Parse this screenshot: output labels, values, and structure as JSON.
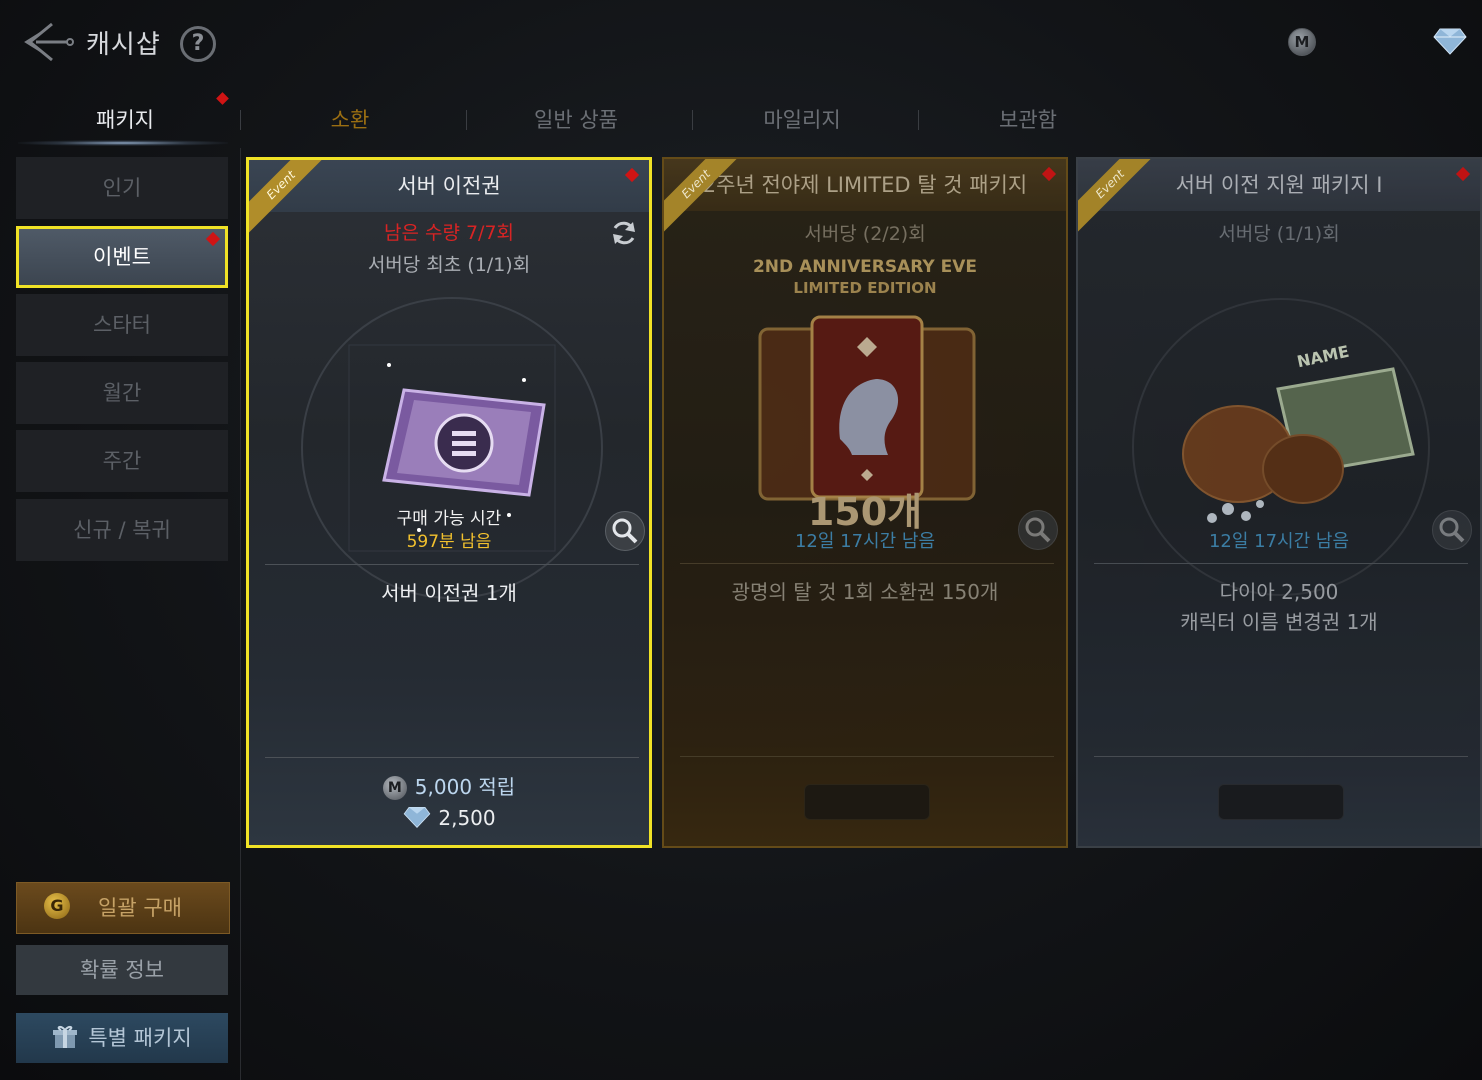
{
  "header": {
    "title": "캐시샵",
    "help_icon": "question-circle-icon",
    "currency_icons": [
      "mileage-coin-icon",
      "diamond-icon"
    ]
  },
  "tabs": [
    {
      "label": "패키지",
      "active": true
    },
    {
      "label": "소환"
    },
    {
      "label": "일반 상품"
    },
    {
      "label": "마일리지"
    },
    {
      "label": "보관함"
    }
  ],
  "sidebar": {
    "items": [
      {
        "label": "인기"
      },
      {
        "label": "이벤트",
        "active": true
      },
      {
        "label": "스타터"
      },
      {
        "label": "월간"
      },
      {
        "label": "주간"
      },
      {
        "label": "신규 / 복귀"
      }
    ],
    "bulk_buy": "일괄 구매",
    "bulk_buy_coin": "G",
    "prob_info": "확률 정보",
    "special_package": "특별 패키지"
  },
  "cards": [
    {
      "ribbon": "Event",
      "title": "서버 이전권",
      "remaining": "남은 수량 7/7회",
      "limit": "서버당 최초 (1/1)회",
      "time_label": "구매 가능 시간",
      "time_left": "597분 남음",
      "contents": [
        "서버 이전권 1개"
      ],
      "mileage": "5,000 적립",
      "price": "2,500"
    },
    {
      "ribbon": "Event",
      "title": "2주년 전야제 LIMITED 탈 것 패키지",
      "limit": "서버당 (2/2)회",
      "art_line1": "2ND ANNIVERSARY EVE",
      "art_line2": "LIMITED EDITION",
      "art_count": "150개",
      "time_left": "12일 17시간 남음",
      "contents": [
        "광명의 탈 것 1회 소환권 150개"
      ]
    },
    {
      "ribbon": "Event",
      "title": "서버 이전 지원 패키지 I",
      "limit": "서버당 (1/1)회",
      "art_text": "NAME",
      "time_left": "12일 17시간 남음",
      "contents": [
        "다이아 2,500",
        "캐릭터 이름 변경권 1개"
      ]
    }
  ],
  "colors": {
    "highlight": "#f0e226",
    "alert_red": "#d01414",
    "time_yellow": "#f2c12e",
    "time_blue": "#3f86b0"
  }
}
